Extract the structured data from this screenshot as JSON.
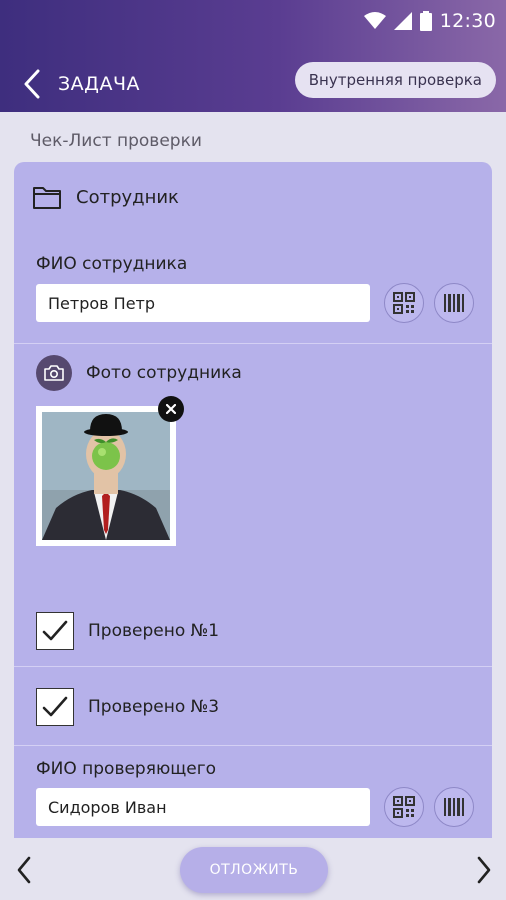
{
  "status": {
    "time": "12:30"
  },
  "appbar": {
    "title": "ЗАДАЧА",
    "chip_label": "Внутренняя проверка"
  },
  "section": {
    "title": "Чек-Лист проверки"
  },
  "card": {
    "header_label": "Сотрудник",
    "employee_field": {
      "label": "ФИО сотрудника",
      "value": "Петров Петр"
    },
    "photo": {
      "label": "Фото сотрудника"
    },
    "checks": [
      {
        "label": "Проверено №1",
        "checked": true
      },
      {
        "label": "Проверено №3",
        "checked": true
      }
    ],
    "inspector_field": {
      "label": "ФИО проверяющего",
      "value": "Сидоров Иван"
    }
  },
  "bottom": {
    "postpone_label": "ОТЛОЖИТЬ"
  },
  "colors": {
    "topbar_start": "#3e2e7e",
    "topbar_end": "#8a68a8",
    "card_bg": "#b6b1ea",
    "page_bg": "#e4e3ef"
  }
}
